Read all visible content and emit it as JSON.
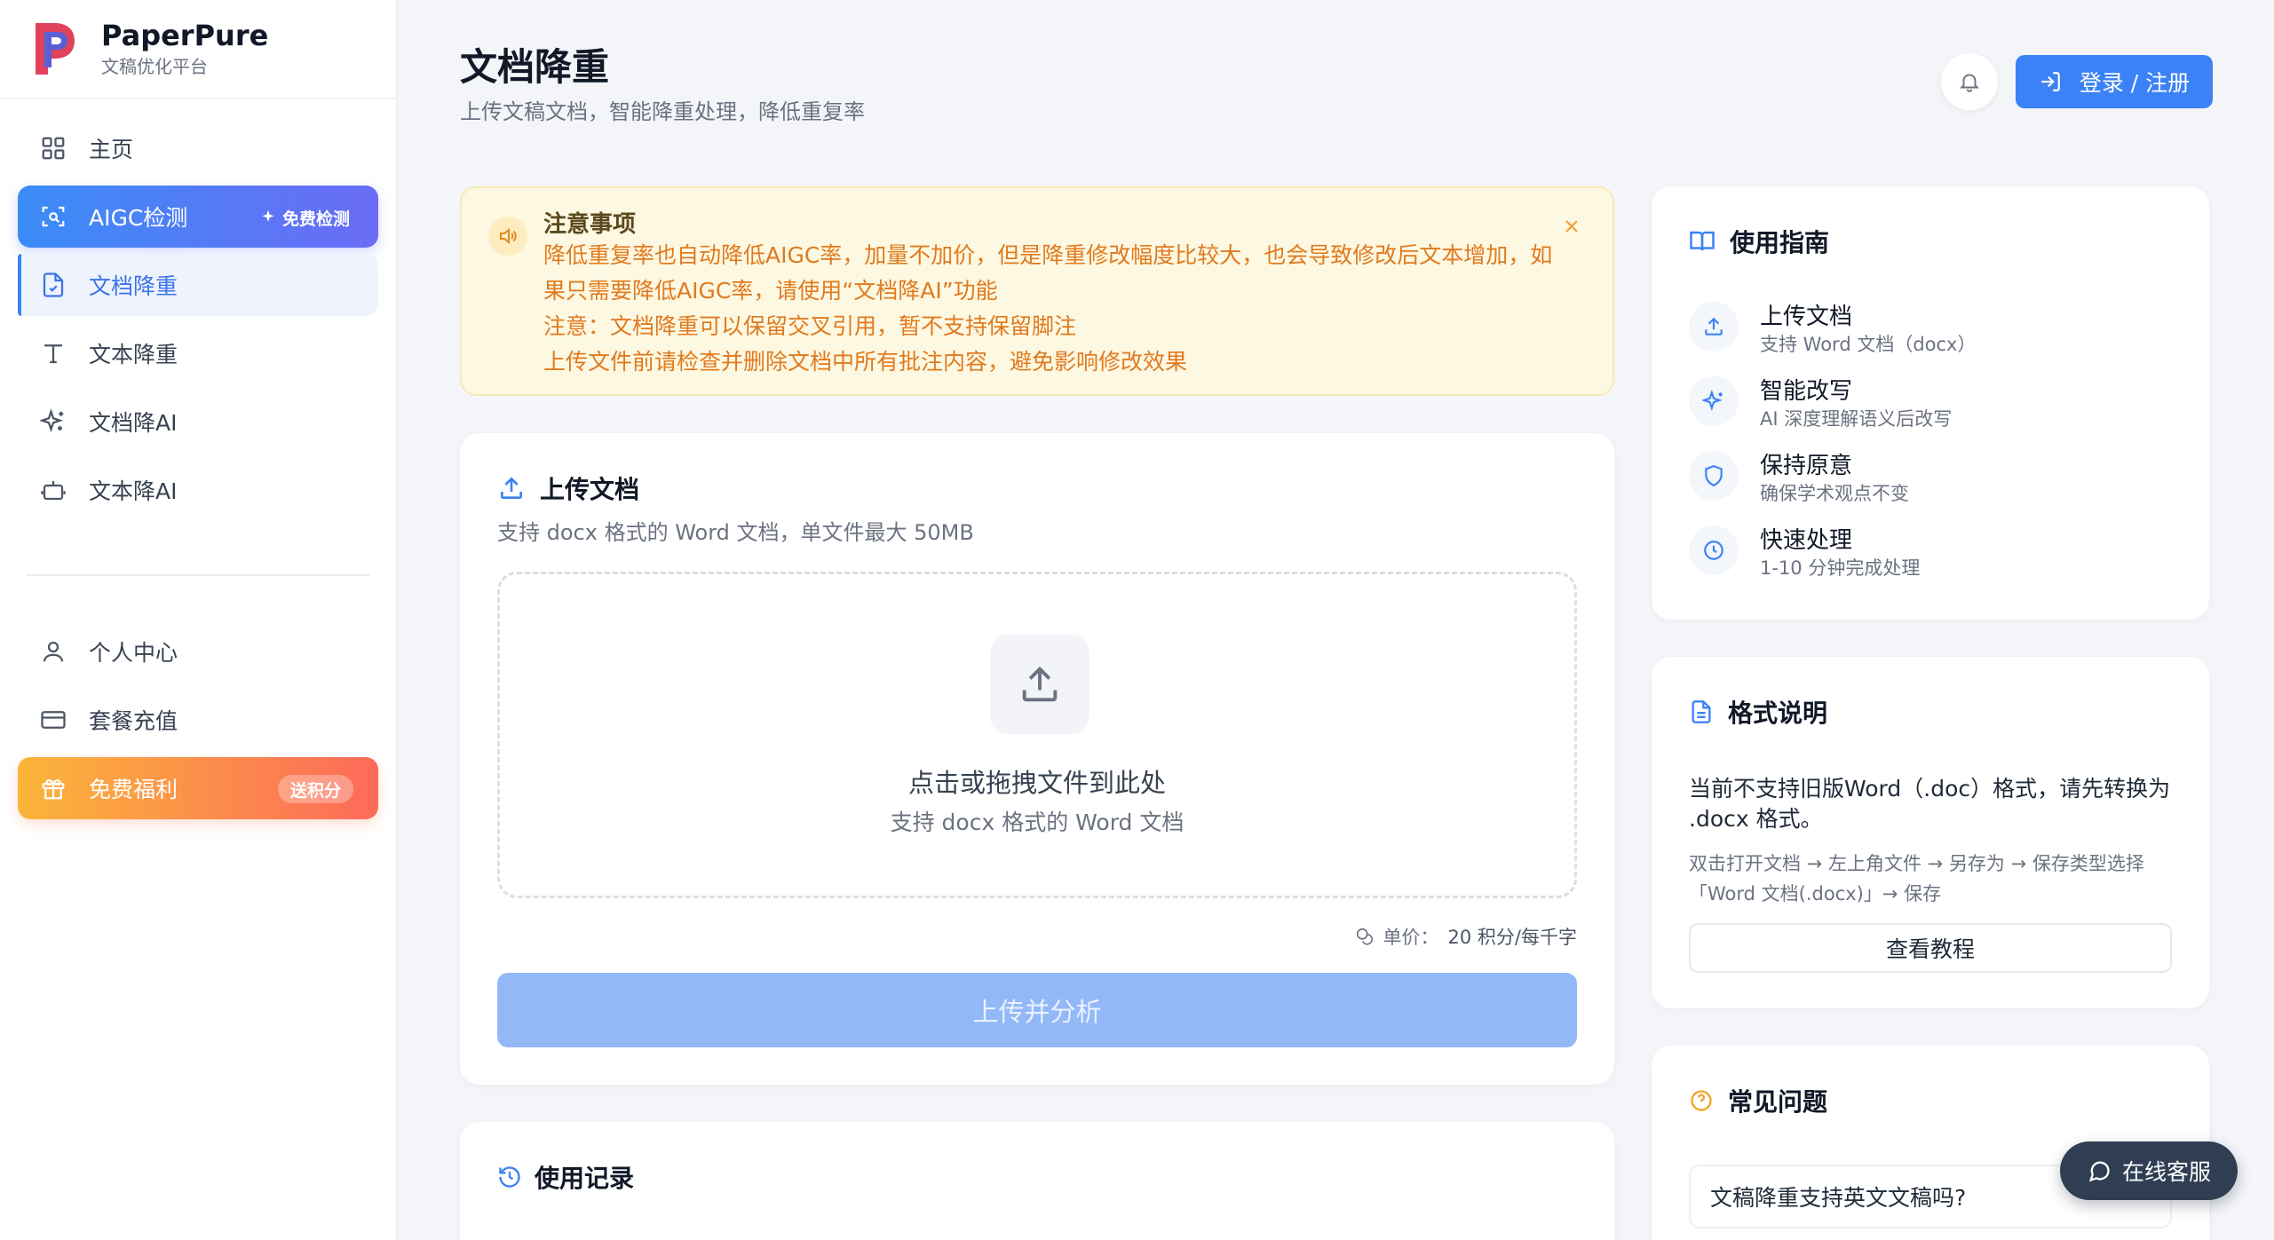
{
  "brand": {
    "name": "PaperPure",
    "subtitle": "文稿优化平台"
  },
  "sidebar": {
    "items": [
      {
        "label": "主页",
        "icon": "grid-icon"
      },
      {
        "label": "AIGC检测",
        "icon": "scan-icon",
        "badge": "免费检测",
        "state": "highlight"
      },
      {
        "label": "文档降重",
        "icon": "file-check-icon",
        "state": "active"
      },
      {
        "label": "文本降重",
        "icon": "text-icon"
      },
      {
        "label": "文档降AI",
        "icon": "sparkles-icon"
      },
      {
        "label": "文本降AI",
        "icon": "bot-icon"
      }
    ],
    "items2": [
      {
        "label": "个人中心",
        "icon": "user-icon"
      },
      {
        "label": "套餐充值",
        "icon": "card-icon"
      },
      {
        "label": "免费福利",
        "icon": "gift-icon",
        "badge": "送积分"
      }
    ]
  },
  "header": {
    "title": "文档降重",
    "subtitle": "上传文稿文档，智能降重处理，降低重复率",
    "login_label": "登录 / 注册"
  },
  "notice": {
    "title": "注意事项",
    "lines": [
      "降低重复率也自动降低AIGC率，加量不加价，但是降重修改幅度比较大，也会导致修改后文本增加，如果只需要降低AIGC率，请使用“文档降AI”功能",
      "注意：文档降重可以保留交叉引用，暂不支持保留脚注",
      "上传文件前请检查并删除文档中所有批注内容，避免影响修改效果"
    ]
  },
  "upload": {
    "title": "上传文档",
    "desc": "支持 docx 格式的 Word 文档，单文件最大 50MB",
    "drop_main": "点击或拖拽文件到此处",
    "drop_sub": "支持 docx 格式的 Word 文档",
    "price_label": "单价：",
    "price_value": "20 积分/每千字",
    "submit_label": "上传并分析"
  },
  "history": {
    "title": "使用记录"
  },
  "guide": {
    "title": "使用指南",
    "items": [
      {
        "title": "上传文档",
        "desc": "支持 Word 文档（docx）",
        "icon": "upload-icon"
      },
      {
        "title": "智能改写",
        "desc": "AI 深度理解语义后改写",
        "icon": "sparkles-icon"
      },
      {
        "title": "保持原意",
        "desc": "确保学术观点不变",
        "icon": "shield-icon"
      },
      {
        "title": "快速处理",
        "desc": "1-10 分钟完成处理",
        "icon": "clock-icon"
      }
    ]
  },
  "format": {
    "title": "格式说明",
    "main": "当前不支持旧版Word（.doc）格式，请先转换为 .docx 格式。",
    "steps": "双击打开文档 → 左上角文件 → 另存为 → 保存类型选择「Word 文档(.docx)」→ 保存",
    "button": "查看教程"
  },
  "faq": {
    "title": "常见问题",
    "q1": "文稿降重支持英文文稿吗?"
  },
  "service": {
    "label": "在线客服"
  },
  "colors": {
    "primary": "#3b82f6",
    "warning": "#e07a1f",
    "sidebar_active": "#eef3fd"
  }
}
